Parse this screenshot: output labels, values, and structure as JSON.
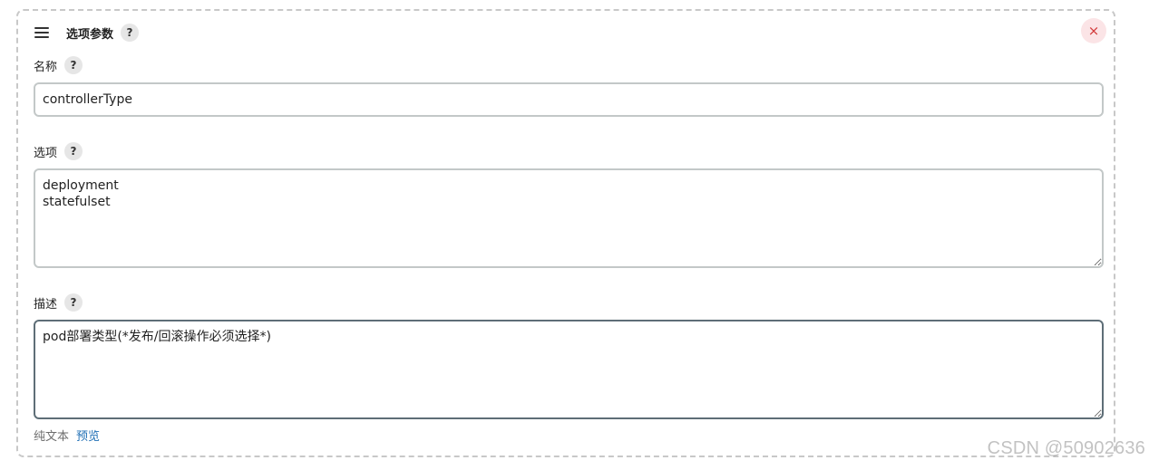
{
  "section": {
    "title": "选项参数",
    "help": "?",
    "close_glyph": "×"
  },
  "fields": {
    "name": {
      "label": "名称",
      "help": "?",
      "value": "controllerType"
    },
    "choices": {
      "label": "选项",
      "help": "?",
      "value": "deployment\nstatefulset"
    },
    "description": {
      "label": "描述",
      "help": "?",
      "value": "pod部署类型(*发布/回滚操作必须选择*)"
    }
  },
  "footer": {
    "plain_text": "纯文本",
    "preview": "预览"
  },
  "watermark": "CSDN @50902636",
  "colors": {
    "close_bg": "#fbe4e6",
    "close_fg": "#d23a3a",
    "link": "#1f6fb5",
    "focused_border": "#5e6e77"
  }
}
